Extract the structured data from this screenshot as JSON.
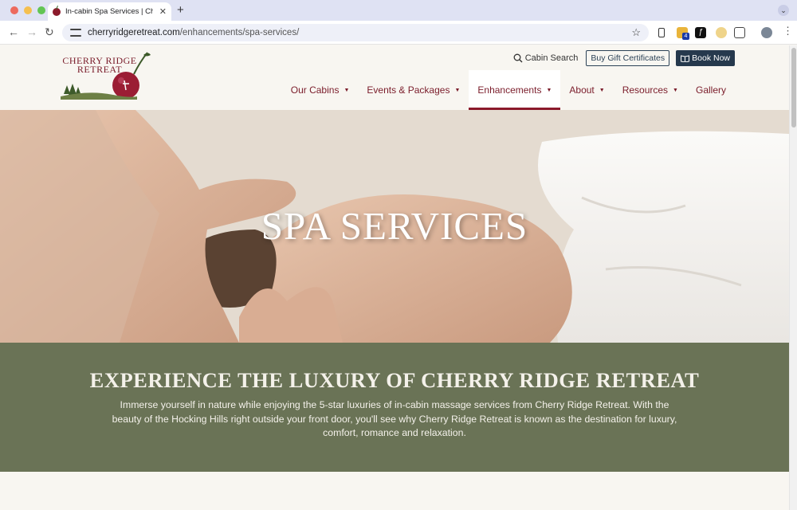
{
  "browser": {
    "tab_title": "In-cabin Spa Services | Cherr",
    "tab_close": "✕",
    "new_tab": "+",
    "url_domain": "cherryridgeretreat.com",
    "url_path": "/enhancements/spa-services/",
    "back": "←",
    "forward": "→",
    "reload": "↻",
    "bookmark": "☆",
    "extension_badge": "4"
  },
  "logo": {
    "line1": "CHERRY RIDGE",
    "line2": "RETREAT"
  },
  "header": {
    "cabin_search": "Cabin Search",
    "gift_certificates": "Buy Gift Certificates",
    "book_now": "Book Now"
  },
  "nav": {
    "items": [
      {
        "label": "Our Cabins",
        "dropdown": true
      },
      {
        "label": "Events & Packages",
        "dropdown": true
      },
      {
        "label": "Enhancements",
        "dropdown": true,
        "active": true
      },
      {
        "label": "About",
        "dropdown": true
      },
      {
        "label": "Resources",
        "dropdown": true
      },
      {
        "label": "Gallery",
        "dropdown": false
      }
    ]
  },
  "hero": {
    "title": "SPA SERVICES"
  },
  "intro": {
    "heading": "EXPERIENCE THE LUXURY OF CHERRY RIDGE RETREAT",
    "text": "Immerse yourself in nature while enjoying the 5-star luxuries of in-cabin massage services from Cherry Ridge Retreat. With the beauty of the Hocking Hills right outside your front door, you'll see why Cherry Ridge Retreat is known as the destination for luxury, comfort, romance and relaxation."
  },
  "colors": {
    "brand_red": "#7a1c2a",
    "navy": "#26394d",
    "olive": "#6a7356",
    "cream": "#f8f6f1"
  }
}
